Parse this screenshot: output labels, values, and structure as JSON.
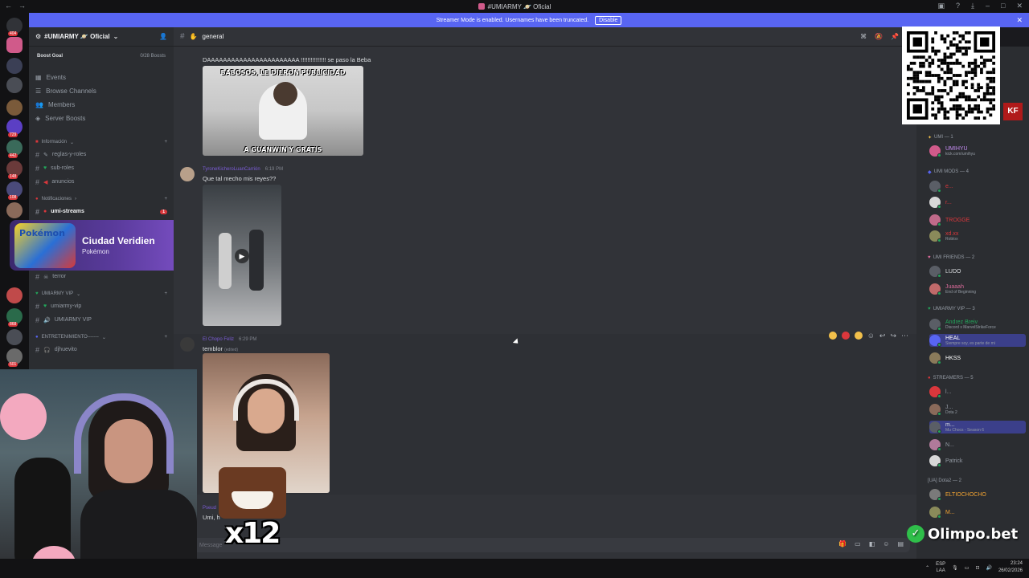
{
  "window": {
    "title": "#UMIARMY 🪐 Oficial"
  },
  "banner": {
    "text": "Streamer Mode is enabled. Usernames have been truncated.",
    "disable_label": "Disable"
  },
  "guild_badges": [
    "404",
    "729",
    "442",
    "148",
    "108",
    "868",
    "501"
  ],
  "server": {
    "name": "#UMIARMY 🪐 Oficial",
    "boost_goal": "Boost Goal",
    "boosts": "0/28 Boosts"
  },
  "nav": [
    "Events",
    "Browse Channels",
    "Members",
    "Server Boosts"
  ],
  "categories": {
    "info": "Información",
    "notif": "Notificaciones",
    "vip": "UMIARMY VIP",
    "ent": "ENTRETENIMIENTO-------"
  },
  "channels": {
    "info": [
      "reglas-y-roles",
      "sub-roles",
      "anuncios"
    ],
    "notif": [
      "umi-streams"
    ],
    "notif_unread": "1",
    "misc": [
      "terror"
    ],
    "vip": [
      "umiarmy-vip",
      "UMIARMY VIP"
    ],
    "ent": [
      "djhuevito"
    ]
  },
  "activity": {
    "title": "Ciudad Veridien",
    "game": "Pokémon",
    "art_label": "Pokémon"
  },
  "chat": {
    "channel": "general",
    "msg1_text": "DAAAAAAAAAAAAAAAAAAAAAAA !!!!!!!!!!!!!!! se paso la Beba",
    "meme_top": "BABOSOS, LE DIERON PUBLICIDAD",
    "meme_bottom": "A GUANWIN Y GRATIS",
    "msg2_author": "TyroneKicheroLuanCarrión",
    "msg2_time": "6:19 PM",
    "msg2_text": "Que tal mecho mis reyes??",
    "msg3_author": "El Chopo Feliz",
    "msg3_time": "6:29 PM",
    "msg3_text": "temblor",
    "msg3_edited": "(edited)",
    "msg4_author": "Pseud",
    "msg4_text": "Umi, h",
    "composer_placeholder": "Message"
  },
  "sticker": {
    "text": "x12"
  },
  "members": {
    "umi": {
      "label": "UMI — 1",
      "name": "UMIHYU",
      "sub": "kick.com/umihyu"
    },
    "mods": {
      "label": "UMI MODS — 4",
      "names": [
        "e...",
        "r...",
        "TROGGE",
        "xd.xx"
      ],
      "subs": [
        "",
        "",
        "",
        "Roblox"
      ]
    },
    "friends": {
      "label": "UMI FRIENDS — 2",
      "names": [
        "LUDO",
        "Juaaah"
      ],
      "subs": [
        "",
        "End of Beginning"
      ]
    },
    "vip": {
      "label": "UMIARMY VIP — 3",
      "names": [
        "Andrez Breiv",
        "HEAL",
        "HKSS"
      ],
      "subs": [
        "Discord x MarvelStrikeForce",
        "Siempre soy, es parte de mi",
        ""
      ]
    },
    "streamers": {
      "label": "STREAMERS — 5",
      "names": [
        "l...",
        "J...",
        "m...",
        "N...",
        "Patrick"
      ],
      "subs": [
        "",
        "Dota 2",
        "Mu Chocs - Season 6",
        "",
        ""
      ]
    },
    "dota": {
      "label": "[UA] Dota2 — 2",
      "names": [
        "ELTIOCHOCHO",
        "M..."
      ]
    }
  },
  "overlay": {
    "qr_corner": "KF",
    "sponsor": "Olimpo.bet"
  },
  "tray": {
    "lang_top": "ESP",
    "lang_bottom": "LAA",
    "time": "23:24",
    "date": "26/02/2026"
  },
  "colors": {
    "accent": "#5865f2",
    "bg": "#313338",
    "sidebar": "#2b2d31",
    "rail": "#121214",
    "mention": "#da373c",
    "online": "#23a55a"
  }
}
